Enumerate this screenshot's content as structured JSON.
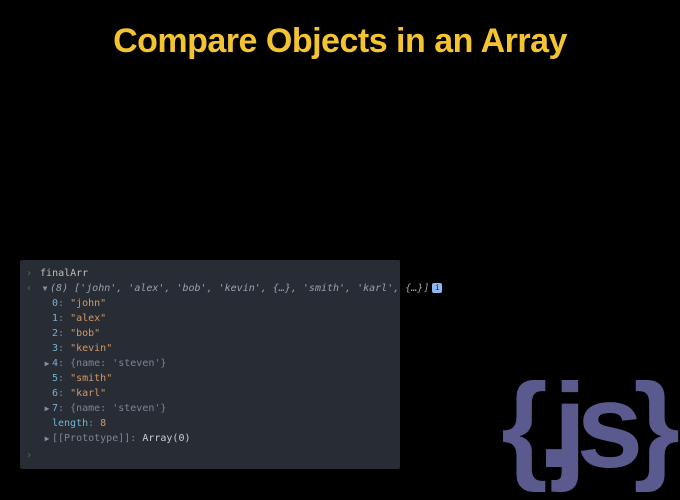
{
  "title": "Compare Objects in an Array",
  "logo": "{.js}",
  "console": {
    "input_var": "finalArr",
    "count_prefix": "(8)",
    "preview": "['john', 'alex', 'bob', 'kevin', {…}, 'smith', 'karl', {…}]",
    "info_badge": "i",
    "entries": [
      {
        "idx": "0",
        "display": "\"john\"",
        "expandable": false
      },
      {
        "idx": "1",
        "display": "\"alex\"",
        "expandable": false
      },
      {
        "idx": "2",
        "display": "\"bob\"",
        "expandable": false
      },
      {
        "idx": "3",
        "display": "\"kevin\"",
        "expandable": false
      },
      {
        "idx": "4",
        "display": "{name: 'steven'}",
        "expandable": true
      },
      {
        "idx": "5",
        "display": "\"smith\"",
        "expandable": false
      },
      {
        "idx": "6",
        "display": "\"karl\"",
        "expandable": false
      },
      {
        "idx": "7",
        "display": "{name: 'steven'}",
        "expandable": true
      }
    ],
    "length_key": "length",
    "length_val": "8",
    "proto_key": "[[Prototype]]",
    "proto_val": "Array(0)"
  }
}
